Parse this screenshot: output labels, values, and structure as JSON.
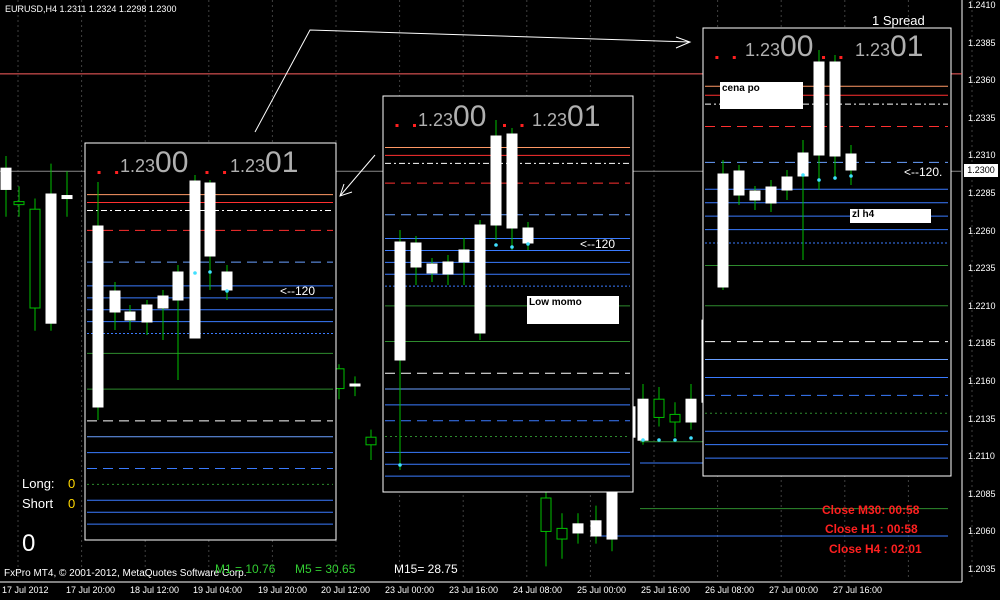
{
  "window": {
    "symbol_line": "EURUSD,H4  1.2311 1.2324 1.2298 1.2300"
  },
  "spread": "1 Spread",
  "current_price": "1.2300",
  "y_axis": [
    "1.2410",
    "1.2385",
    "1.2360",
    "1.2335",
    "1.2310",
    "1.2285",
    "1.2260",
    "1.2235",
    "1.2210",
    "1.2185",
    "1.2160",
    "1.2135",
    "1.2110",
    "1.2085",
    "1.2060",
    "1.2035"
  ],
  "x_axis": [
    "17 Jul 2012",
    "17 Jul 20:00",
    "18 Jul 12:00",
    "19 Jul 04:00",
    "19 Jul 20:00",
    "20 Jul 12:00",
    "23 Jul 00:00",
    "23 Jul 16:00",
    "24 Jul 08:00",
    "25 Jul 00:00",
    "25 Jul 16:00",
    "26 Jul 08:00",
    "27 Jul 00:00",
    "27 Jul 16:00"
  ],
  "price_display": {
    "small_a": "1.23",
    "big_a": "00",
    "small_b": "1.23",
    "big_b": "01"
  },
  "arrow_label": "<--120",
  "arrow_label_main": "<--120.",
  "notes": {
    "cena_po": "cena po",
    "low_momo": "Low momo",
    "zl_h4": "zl h4"
  },
  "positions": {
    "long_label": "Long:",
    "long_value": "0",
    "short_label": "Short",
    "short_value": "0"
  },
  "big_zero": "0",
  "footer": {
    "copyright": "FxPro MT4, © 2001-2012, MetaQuotes Software Corp.",
    "m1": "M1 = 10.76",
    "m5": "M5 = 30.65",
    "m15": "M15= 28.75"
  },
  "close_times": [
    "Close M30: 00:58",
    "Close H1 :  00:58",
    "Close H4 :  02:01"
  ],
  "colors": {
    "bull": "#ffffff",
    "bear": "#000000",
    "wick": "#00c000",
    "resistance": "#ff3030",
    "support": "#3a7bff",
    "green_dash": "#2e8b2e",
    "grid": "#404040"
  }
}
